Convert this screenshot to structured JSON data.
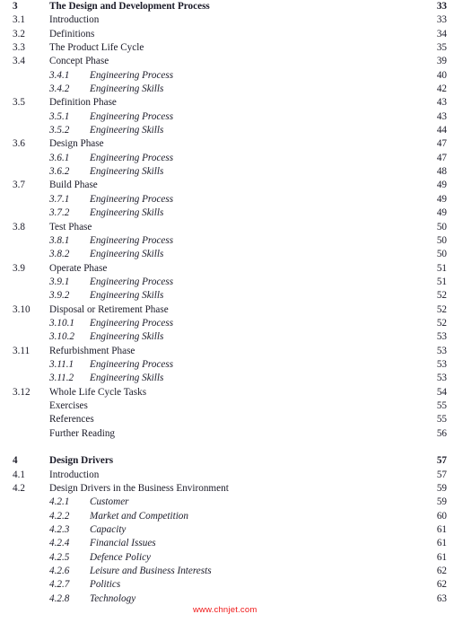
{
  "document": {
    "type": "table-of-contents",
    "text_color": "#1b1b28",
    "background_color": "#ffffff"
  },
  "watermark": {
    "text": "www.chnjet.com",
    "color": "#f01616"
  },
  "toc": {
    "entries": [
      {
        "level": "chapter",
        "number": "3",
        "title": "The Design and Development Process",
        "page": "33"
      },
      {
        "level": "section",
        "number": "3.1",
        "title": "Introduction",
        "page": "33"
      },
      {
        "level": "section",
        "number": "3.2",
        "title": "Definitions",
        "page": "34"
      },
      {
        "level": "section",
        "number": "3.3",
        "title": "The Product Life Cycle",
        "page": "35"
      },
      {
        "level": "section",
        "number": "3.4",
        "title": "Concept Phase",
        "page": "39"
      },
      {
        "level": "subsection",
        "number": "3.4.1",
        "title": "Engineering Process",
        "page": "40"
      },
      {
        "level": "subsection",
        "number": "3.4.2",
        "title": "Engineering Skills",
        "page": "42"
      },
      {
        "level": "section",
        "number": "3.5",
        "title": "Definition Phase",
        "page": "43"
      },
      {
        "level": "subsection",
        "number": "3.5.1",
        "title": "Engineering Process",
        "page": "43"
      },
      {
        "level": "subsection",
        "number": "3.5.2",
        "title": "Engineering Skills",
        "page": "44"
      },
      {
        "level": "section",
        "number": "3.6",
        "title": "Design Phase",
        "page": "47"
      },
      {
        "level": "subsection",
        "number": "3.6.1",
        "title": "Engineering Process",
        "page": "47"
      },
      {
        "level": "subsection",
        "number": "3.6.2",
        "title": "Engineering Skills",
        "page": "48"
      },
      {
        "level": "section",
        "number": "3.7",
        "title": "Build Phase",
        "page": "49"
      },
      {
        "level": "subsection",
        "number": "3.7.1",
        "title": "Engineering Process",
        "page": "49"
      },
      {
        "level": "subsection",
        "number": "3.7.2",
        "title": "Engineering Skills",
        "page": "49"
      },
      {
        "level": "section",
        "number": "3.8",
        "title": "Test Phase",
        "page": "50"
      },
      {
        "level": "subsection",
        "number": "3.8.1",
        "title": "Engineering Process",
        "page": "50"
      },
      {
        "level": "subsection",
        "number": "3.8.2",
        "title": "Engineering Skills",
        "page": "50"
      },
      {
        "level": "section",
        "number": "3.9",
        "title": "Operate Phase",
        "page": "51"
      },
      {
        "level": "subsection",
        "number": "3.9.1",
        "title": "Engineering Process",
        "page": "51"
      },
      {
        "level": "subsection",
        "number": "3.9.2",
        "title": "Engineering Skills",
        "page": "52"
      },
      {
        "level": "section",
        "number": "3.10",
        "title": "Disposal or Retirement Phase",
        "page": "52"
      },
      {
        "level": "subsection",
        "number": "3.10.1",
        "title": "Engineering Process",
        "page": "52"
      },
      {
        "level": "subsection",
        "number": "3.10.2",
        "title": "Engineering Skills",
        "page": "53"
      },
      {
        "level": "section",
        "number": "3.11",
        "title": "Refurbishment Phase",
        "page": "53"
      },
      {
        "level": "subsection",
        "number": "3.11.1",
        "title": "Engineering Process",
        "page": "53"
      },
      {
        "level": "subsection",
        "number": "3.11.2",
        "title": "Engineering Skills",
        "page": "53"
      },
      {
        "level": "section",
        "number": "3.12",
        "title": "Whole Life Cycle Tasks",
        "page": "54"
      },
      {
        "level": "backmatter",
        "number": "",
        "title": "Exercises",
        "page": "55"
      },
      {
        "level": "backmatter",
        "number": "",
        "title": "References",
        "page": "55"
      },
      {
        "level": "backmatter",
        "number": "",
        "title": "Further Reading",
        "page": "56"
      },
      {
        "level": "spacer",
        "number": "",
        "title": "",
        "page": ""
      },
      {
        "level": "chapter",
        "number": "4",
        "title": "Design Drivers",
        "page": "57"
      },
      {
        "level": "section",
        "number": "4.1",
        "title": "Introduction",
        "page": "57"
      },
      {
        "level": "section",
        "number": "4.2",
        "title": "Design Drivers in the Business Environment",
        "page": "59"
      },
      {
        "level": "subsection",
        "number": "4.2.1",
        "title": "Customer",
        "page": "59"
      },
      {
        "level": "subsection",
        "number": "4.2.2",
        "title": "Market and Competition",
        "page": "60"
      },
      {
        "level": "subsection",
        "number": "4.2.3",
        "title": "Capacity",
        "page": "61"
      },
      {
        "level": "subsection",
        "number": "4.2.4",
        "title": "Financial Issues",
        "page": "61"
      },
      {
        "level": "subsection",
        "number": "4.2.5",
        "title": "Defence Policy",
        "page": "61"
      },
      {
        "level": "subsection",
        "number": "4.2.6",
        "title": "Leisure and Business Interests",
        "page": "62"
      },
      {
        "level": "subsection",
        "number": "4.2.7",
        "title": "Politics",
        "page": "62"
      },
      {
        "level": "subsection",
        "number": "4.2.8",
        "title": "Technology",
        "page": "63"
      }
    ]
  }
}
